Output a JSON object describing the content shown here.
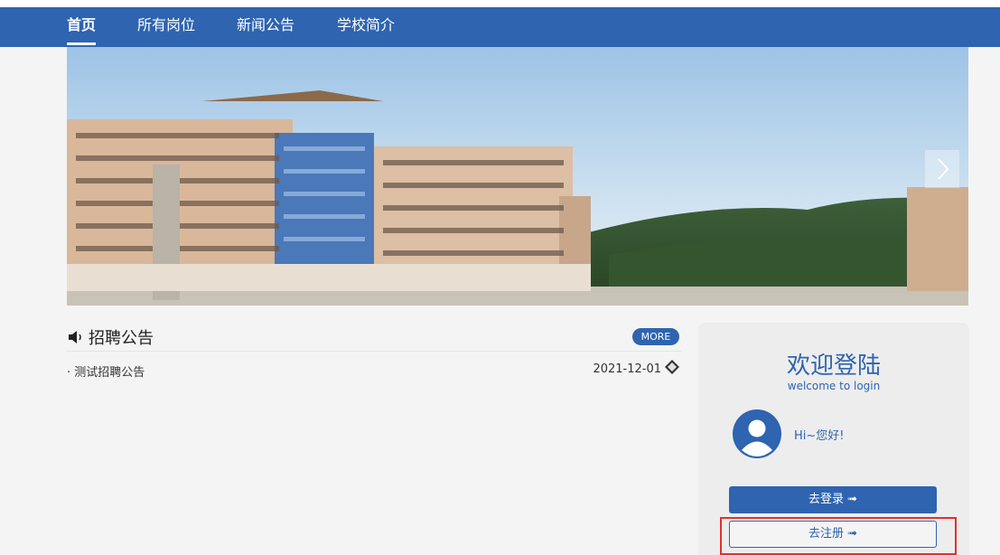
{
  "nav": {
    "items": [
      {
        "label": "首页",
        "active": true
      },
      {
        "label": "所有岗位",
        "active": false
      },
      {
        "label": "新闻公告",
        "active": false
      },
      {
        "label": "学校简介",
        "active": false
      }
    ]
  },
  "announcements": {
    "title": "招聘公告",
    "more_label": "MORE",
    "items": [
      {
        "title": "· 测试招聘公告",
        "date": "2021-12-01"
      }
    ]
  },
  "login": {
    "title": "欢迎登陆",
    "subtitle": "welcome to login",
    "greeting": "Hi~您好!",
    "login_button": "去登录 ➟",
    "register_button": "去注册 ➟"
  },
  "colors": {
    "brand": "#2e64b0",
    "highlight": "#e0322b"
  }
}
